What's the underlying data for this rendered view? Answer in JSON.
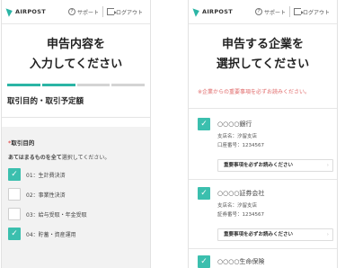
{
  "header": {
    "logo_text": "AIRPOST",
    "support_label": "サポート",
    "logout_label": "ログアウト"
  },
  "left": {
    "title_line1": "申告内容を",
    "title_line2": "入力してください",
    "progress": {
      "completed_steps": 2,
      "total_steps": 4
    },
    "section_title": "取引目的・取引予定額",
    "field_label": "取引目的",
    "required_mark": "*",
    "hint_bold": "あてはまるものを全て",
    "hint_rest": "選択してください。",
    "options": [
      {
        "label": "01：生計費決済",
        "checked": true
      },
      {
        "label": "02：事業性決済",
        "checked": false
      },
      {
        "label": "03：給与受取・年金受取",
        "checked": false
      },
      {
        "label": "04：貯蓄・資産運用",
        "checked": true
      }
    ]
  },
  "right": {
    "title_line1": "申告する企業を",
    "title_line2": "選択してください",
    "notice": "※企業からの重要事項を必ずお読みください。",
    "read_button_label": "重要事項を必ずお読みください",
    "companies": [
      {
        "name": "○○○○銀行",
        "branch": "支店名：汐留支店",
        "account": "口座番号：1234567",
        "checked": true
      },
      {
        "name": "○○○○証券会社",
        "branch": "支店名：汐留支店",
        "account": "証券番号：1234567",
        "checked": true
      },
      {
        "name": "○○○○生命保険",
        "checked": true
      }
    ]
  },
  "colors": {
    "accent": "#2bb5a5",
    "notice": "#e06a6a",
    "form_bg": "#f2f2f2"
  }
}
